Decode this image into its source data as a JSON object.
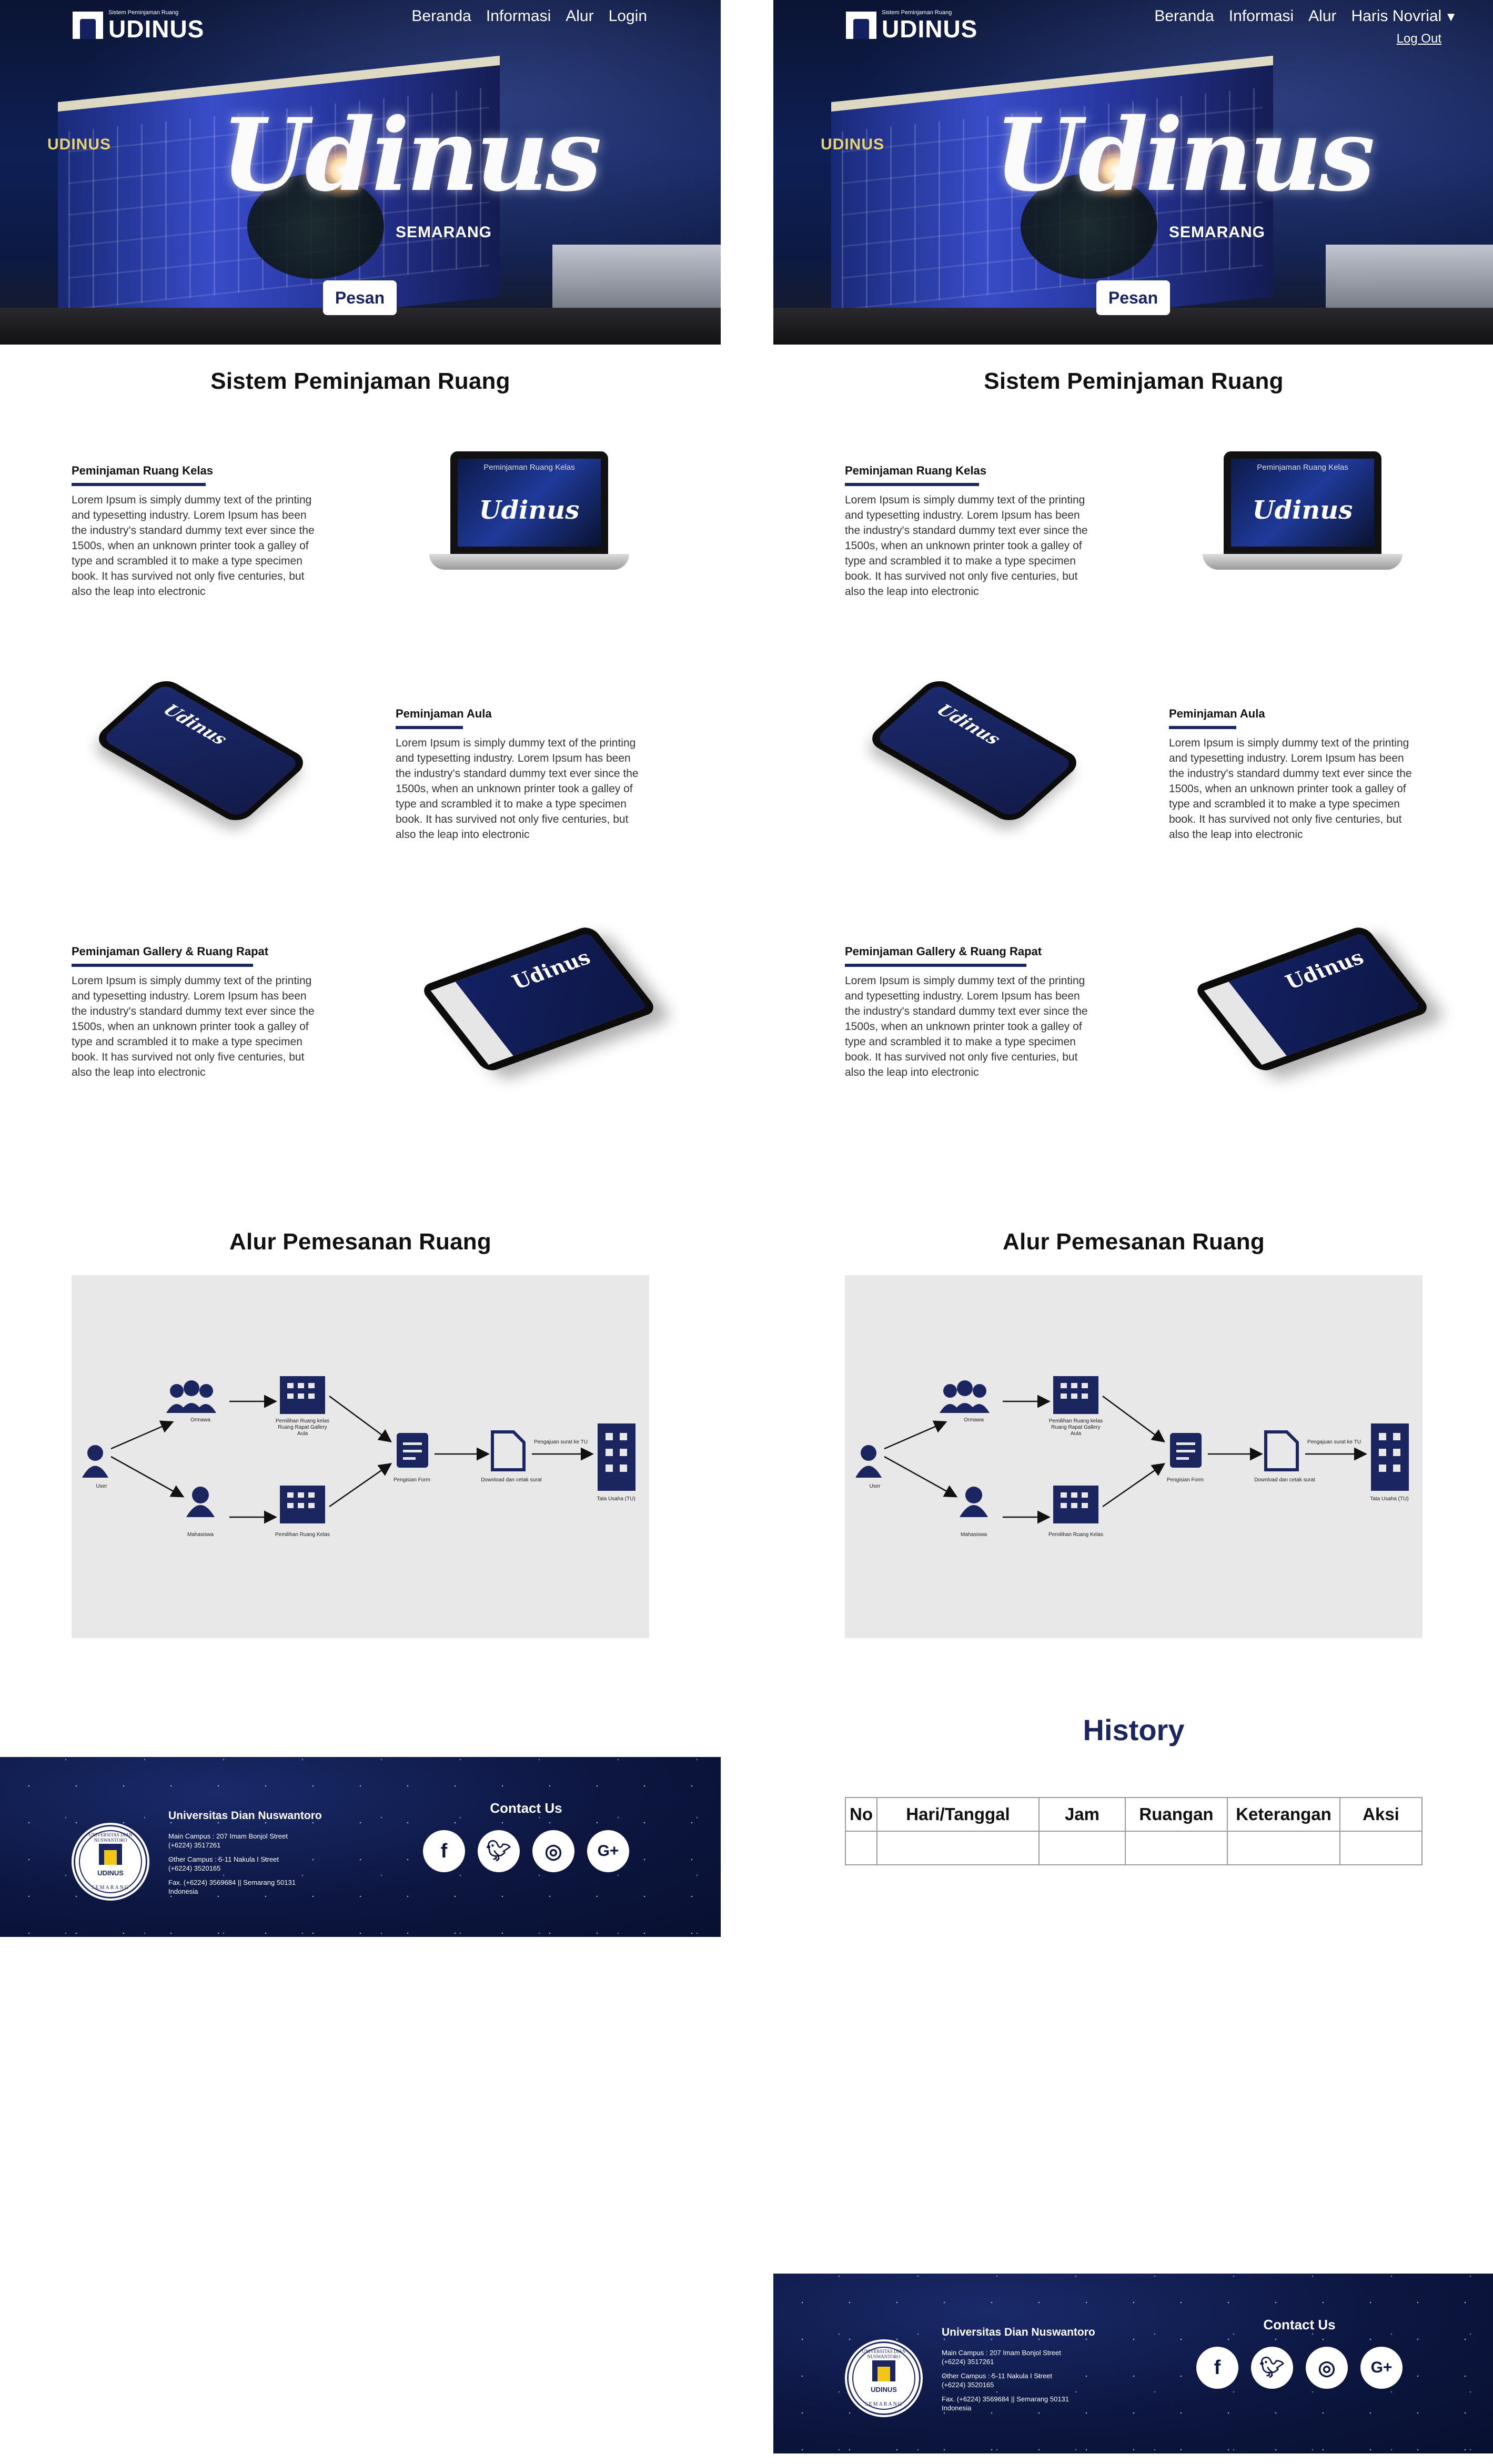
{
  "brand": {
    "logo_small": "Sistem Peminjaman Ruang",
    "logo_big": "UDINUS"
  },
  "left_nav": [
    "Beranda",
    "Informasi",
    "Alur",
    "Login"
  ],
  "right_nav": [
    "Beranda",
    "Informasi",
    "Alur"
  ],
  "user": {
    "name": "Haris Novrial",
    "logout": "Log Out"
  },
  "hero": {
    "building_sign": "UDINUS",
    "script": "Udinus",
    "city": "SEMARANG",
    "button": "Pesan"
  },
  "section_title": "Sistem Peminjaman Ruang",
  "features": [
    {
      "title": "Peminjaman Ruang Kelas",
      "text": "Lorem Ipsum is simply dummy text of the printing and typesetting industry. Lorem Ipsum has been the industry's standard dummy text ever since the 1500s, when an unknown printer took a galley of type and scrambled it to make a type specimen book. It has survived not only five centuries, but also the leap into electronic",
      "screen_title": "Peminjaman Ruang Kelas",
      "screen_script": "Udinus"
    },
    {
      "title": "Peminjaman Aula",
      "text": "Lorem Ipsum is simply dummy text of the printing and typesetting industry. Lorem Ipsum has been the industry's standard dummy text ever since the 1500s, when an unknown printer took a galley of type and scrambled it to make a type specimen book. It has survived not only five centuries, but also the leap into electronic",
      "screen_script": "Udinus"
    },
    {
      "title": "Peminjaman Gallery & Ruang Rapat",
      "text": "Lorem Ipsum is simply dummy text of the printing and typesetting industry. Lorem Ipsum has been the industry's standard dummy text ever since the 1500s, when an unknown printer took a galley of type and scrambled it to make a type specimen book. It has survived not only five centuries, but also the leap into electronic",
      "screen_script": "Udinus"
    }
  ],
  "flow": {
    "title": "Alur Pemesanan Ruang",
    "labels": {
      "user": "User",
      "ormawa": "Ormawa",
      "mahasiswa": "Mahasiswa",
      "pemilihan_top": "Pemilihan Ruang kelas Ruang Rapat Gallery Aula",
      "pemilihan_bottom": "Pemilihan Ruang Kelas",
      "form": "Pengisian Form",
      "download": "Download dan cetak surat",
      "submit": "Pengajuan surat ke TU",
      "tu": "Tata Usaha (TU)"
    }
  },
  "history": {
    "title": "History",
    "columns": [
      "No",
      "Hari/Tanggal",
      "Jam",
      "Ruangan",
      "Keterangan",
      "Aksi"
    ]
  },
  "footer": {
    "seal_top": "UNIVERSITAS DIAN NUSWANTORO",
    "seal_name": "UDINUS",
    "seal_bottom": "SEMARANG",
    "university": "Universitas Dian Nuswantoro",
    "main_campus": "Main Campus : 207 Imam Bonjol Street",
    "main_phone": "(+6224) 3517261",
    "other_campus": "Other Campus : 5-11 Nakula I Street",
    "other_phone": "(+6224) 3520165",
    "fax": "Fax. (+6224) 3569684 || Semarang 50131",
    "country": "Indonesia",
    "contact_title": "Contact Us",
    "social_icons": [
      "facebook-icon",
      "twitter-icon",
      "instagram-icon",
      "google-plus-icon"
    ]
  }
}
